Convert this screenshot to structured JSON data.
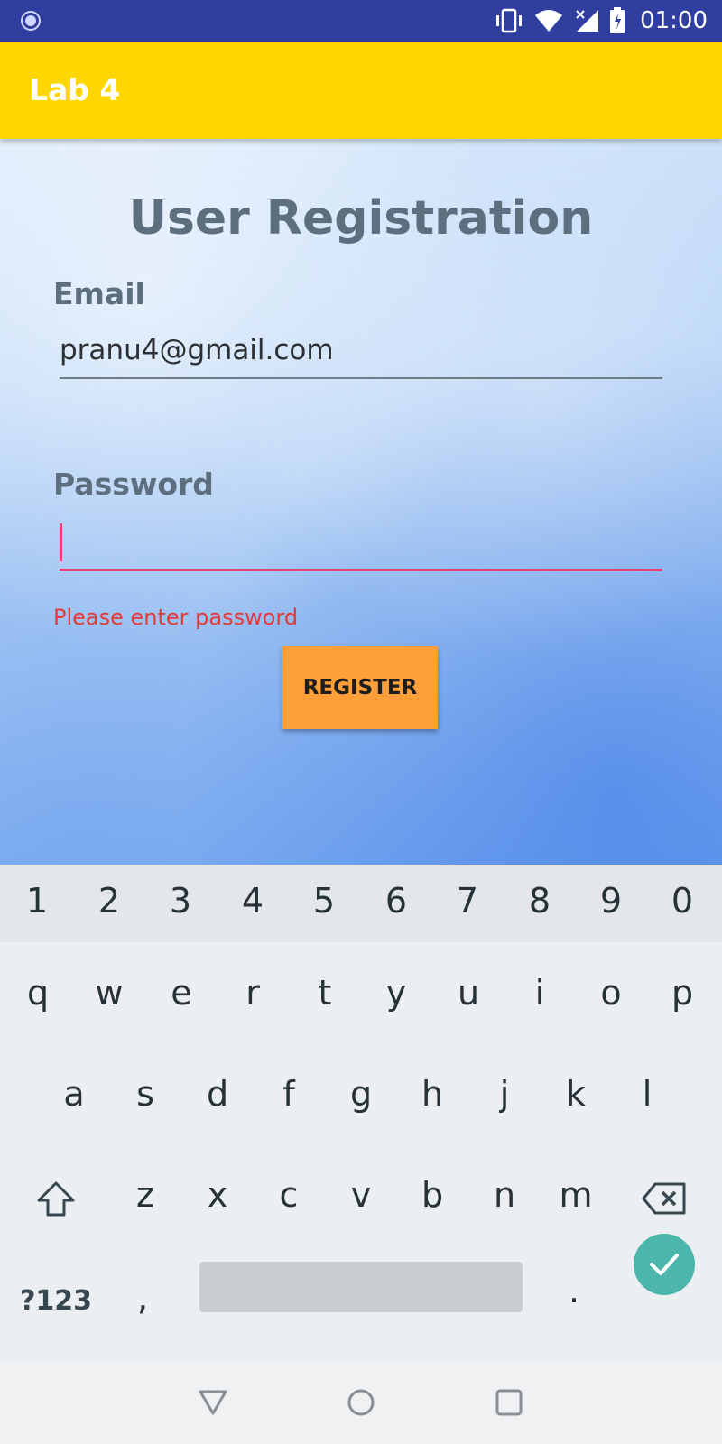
{
  "status_bar": {
    "time": "01:00",
    "icons": [
      "app-notification-icon",
      "vibrate-icon",
      "wifi-icon",
      "signal-icon",
      "battery-icon"
    ]
  },
  "app_bar": {
    "title": "Lab 4",
    "color": "#ffd600"
  },
  "form": {
    "heading": "User Registration",
    "email_label": "Email",
    "email_value": "pranu4@gmail.com",
    "password_label": "Password",
    "password_value": "",
    "error": "Please enter password",
    "register_label": "REGISTER",
    "accent": "#ec407a",
    "button_color": "#ff9f3a"
  },
  "keyboard": {
    "number_row": [
      "1",
      "2",
      "3",
      "4",
      "5",
      "6",
      "7",
      "8",
      "9",
      "0"
    ],
    "row1": [
      "q",
      "w",
      "e",
      "r",
      "t",
      "y",
      "u",
      "i",
      "o",
      "p"
    ],
    "row2": [
      "a",
      "s",
      "d",
      "f",
      "g",
      "h",
      "j",
      "k",
      "l"
    ],
    "row3": [
      "z",
      "x",
      "c",
      "v",
      "b",
      "n",
      "m"
    ],
    "symbols_label": "?123",
    "comma": ",",
    "period": ".",
    "enter_color": "#4db6ac"
  },
  "nav_bar": {
    "buttons": [
      "back-icon",
      "home-icon",
      "recents-icon"
    ]
  }
}
